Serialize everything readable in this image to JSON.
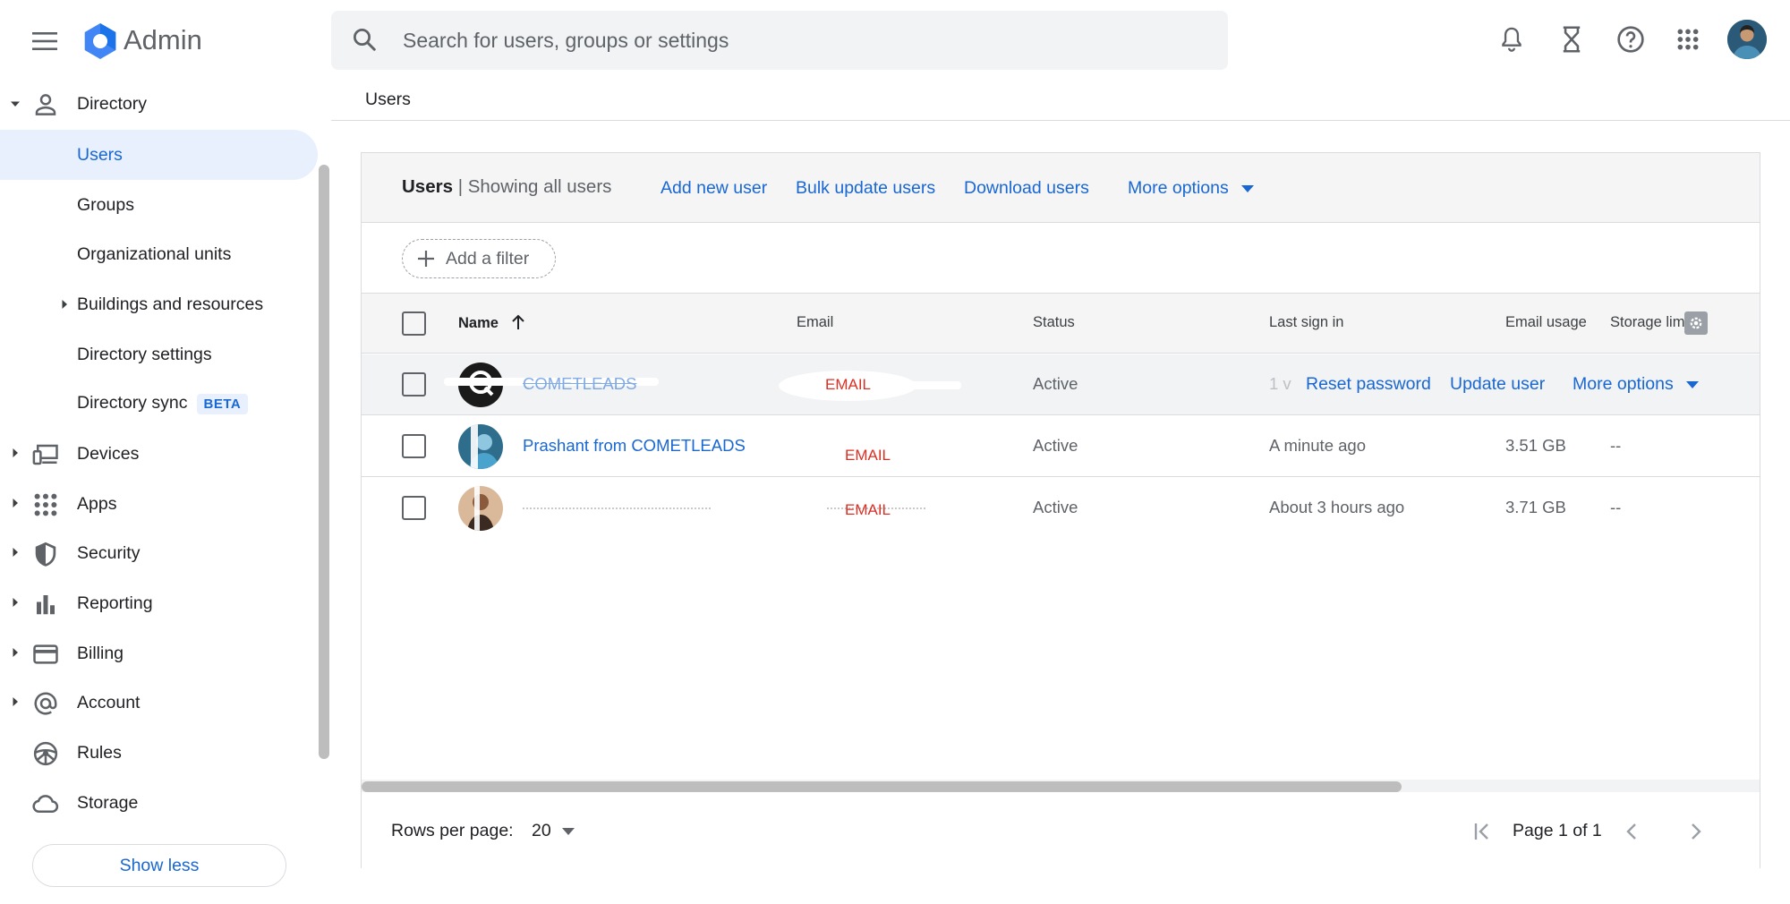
{
  "app": {
    "name": "Admin",
    "search_placeholder": "Search for users, groups or settings"
  },
  "topbar_icons": [
    "notifications-icon",
    "hourglass-icon",
    "help-icon",
    "apps-grid-icon",
    "account-avatar"
  ],
  "sidebar": {
    "items": [
      {
        "label": "Directory",
        "icon": "person-icon",
        "expanded": true
      },
      {
        "label": "Users",
        "active": true
      },
      {
        "label": "Groups"
      },
      {
        "label": "Organizational units"
      },
      {
        "label": "Buildings and resources",
        "collapsed": true
      },
      {
        "label": "Directory settings"
      },
      {
        "label": "Directory sync",
        "badge": "BETA"
      },
      {
        "label": "Devices",
        "icon": "devices-icon"
      },
      {
        "label": "Apps",
        "icon": "apps-icon"
      },
      {
        "label": "Security",
        "icon": "shield-icon"
      },
      {
        "label": "Reporting",
        "icon": "bar-chart-icon"
      },
      {
        "label": "Billing",
        "icon": "credit-card-icon"
      },
      {
        "label": "Account",
        "icon": "at-sign-icon"
      },
      {
        "label": "Rules",
        "icon": "steering-wheel-icon"
      },
      {
        "label": "Storage",
        "icon": "cloud-icon"
      }
    ],
    "show_less": "Show less"
  },
  "breadcrumb": "Users",
  "panel": {
    "title": "Users",
    "separator": "|",
    "subtitle": "Showing all users",
    "actions": [
      "Add new user",
      "Bulk update users",
      "Download users",
      "More options"
    ],
    "filter": "Add a filter"
  },
  "table": {
    "columns": [
      "Name",
      "Email",
      "Status",
      "Last sign in",
      "Email usage",
      "Storage limit"
    ],
    "rows": [
      {
        "name": "COMETLEADS",
        "email": "EMAIL",
        "status": "Active",
        "last_sign_in": "1 v",
        "row_actions": [
          "Reset password",
          "Update user",
          "More options"
        ]
      },
      {
        "name": "Prashant from COMETLEADS",
        "email": "EMAIL",
        "status": "Active",
        "last_sign_in": "A minute ago",
        "email_usage": "3.51 GB",
        "storage_limit": "--"
      },
      {
        "name": "",
        "email": "EMAIL",
        "status": "Active",
        "last_sign_in": "About 3 hours ago",
        "email_usage": "3.71 GB",
        "storage_limit": "--"
      }
    ]
  },
  "footer": {
    "rows_per_page_label": "Rows per page:",
    "rows_per_page": "20",
    "page": "Page 1 of 1"
  },
  "colors": {
    "accent": "#1967d2",
    "active_bg": "#e8f0fe",
    "logo": "#4285f4"
  }
}
